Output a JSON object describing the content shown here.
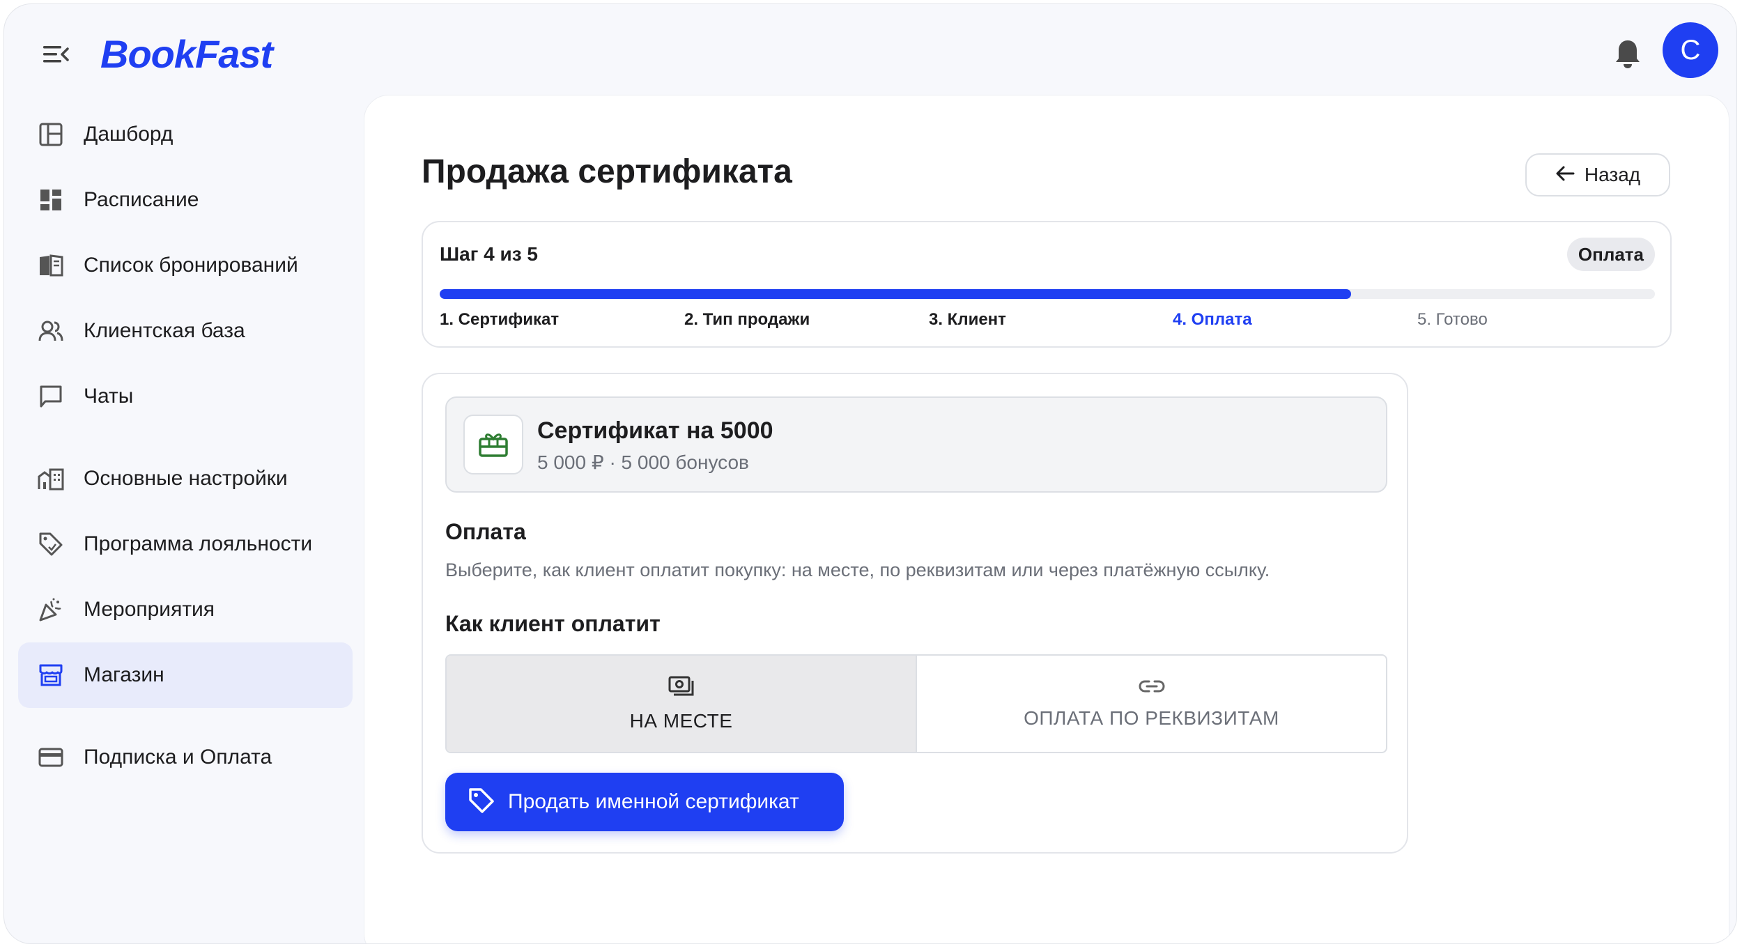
{
  "app": {
    "logo": "BookFast",
    "avatar_letter": "C",
    "brand_color": "#1f3ff2"
  },
  "sidebar": {
    "items": [
      {
        "label": "Дашборд",
        "icon": "dashboard-icon"
      },
      {
        "label": "Расписание",
        "icon": "schedule-icon"
      },
      {
        "label": "Список бронирований",
        "icon": "bookings-icon"
      },
      {
        "label": "Клиентская база",
        "icon": "clients-icon"
      },
      {
        "label": "Чаты",
        "icon": "chat-icon"
      },
      {
        "label": "Основные настройки",
        "icon": "settings-building-icon"
      },
      {
        "label": "Программа лояльности",
        "icon": "loyalty-tag-icon"
      },
      {
        "label": "Мероприятия",
        "icon": "party-icon"
      },
      {
        "label": "Магазин",
        "icon": "store-icon",
        "active": true
      },
      {
        "label": "Подписка и Оплата",
        "icon": "credit-card-icon"
      }
    ]
  },
  "page": {
    "title": "Продажа сертификата",
    "back_label": "Назад"
  },
  "stepper": {
    "count_label": "Шаг 4 из 5",
    "current_badge": "Оплата",
    "progress": 0.75,
    "steps": [
      "1. Сертификат",
      "2. Тип продажи",
      "3. Клиент",
      "4. Оплата",
      "5. Готово"
    ],
    "current_index": 3
  },
  "certificate": {
    "name": "Сертификат на 5000",
    "details": "5 000 ₽ · 5 000 бонусов",
    "icon": "gift-card-icon"
  },
  "payment": {
    "title": "Оплата",
    "description": "Выберите, как клиент оплатит покупку: на месте, по реквизитам или через платёжную ссылку.",
    "method_title": "Как клиент оплатит",
    "options": [
      {
        "label": "НА МЕСТЕ",
        "icon": "cash-icon",
        "selected": true
      },
      {
        "label": "ОПЛАТА ПО РЕКВИЗИТАМ",
        "icon": "link-icon",
        "selected": false
      }
    ],
    "submit_label": "Продать именной сертификат"
  }
}
